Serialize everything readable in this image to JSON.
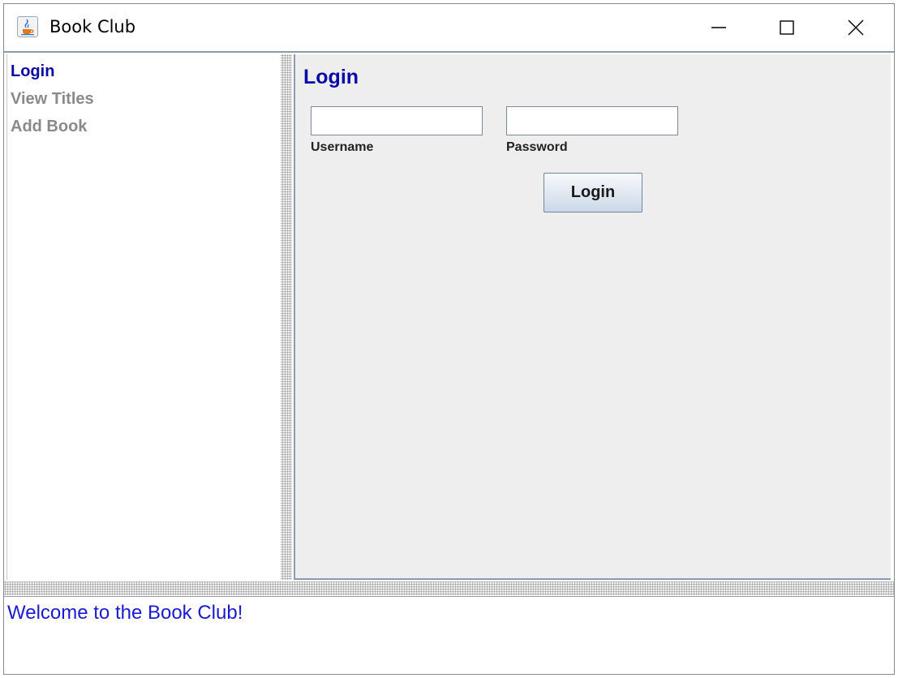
{
  "window": {
    "title": "Book Club",
    "icon": "java-coffee-cup-icon",
    "controls": [
      "minimize-icon",
      "maximize-icon",
      "close-icon"
    ]
  },
  "nav": {
    "items": [
      {
        "label": "Login",
        "active": true
      },
      {
        "label": "View Titles",
        "active": false
      },
      {
        "label": "Add Book",
        "active": false
      }
    ]
  },
  "login_panel": {
    "title": "Login",
    "username": {
      "label": "Username",
      "value": ""
    },
    "password": {
      "label": "Password",
      "value": ""
    },
    "submit_label": "Login"
  },
  "status": {
    "message": "Welcome to the Book Club!"
  },
  "colors": {
    "accent_text": "#0a0aa8",
    "inactive_text": "#8a8a8a",
    "status_text": "#1a1ad0",
    "panel_bg": "#eeeeee"
  }
}
